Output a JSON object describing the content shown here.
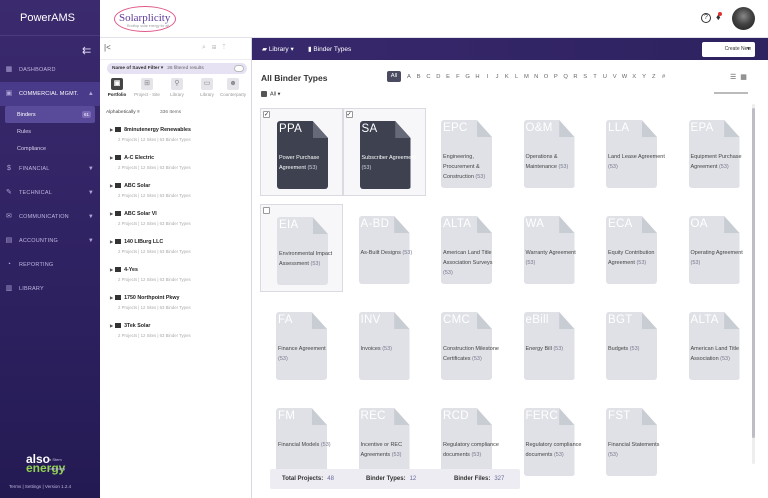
{
  "app": {
    "title": "PowerAMS"
  },
  "nav": {
    "collapse_icon": "collapse-left-icon",
    "items": [
      {
        "label": "DASHBOARD",
        "icon": "dashboard-icon"
      },
      {
        "label": "COMMERCIAL MGMT.",
        "icon": "briefcase-icon",
        "open": true
      },
      {
        "label": "FINANCIAL",
        "icon": "dollar-icon"
      },
      {
        "label": "TECHNICAL",
        "icon": "wrench-icon"
      },
      {
        "label": "COMMUNICATION",
        "icon": "chat-icon"
      },
      {
        "label": "ACCOUNTING",
        "icon": "calculator-icon"
      },
      {
        "label": "REPORTING",
        "icon": "report-icon"
      },
      {
        "label": "LIBRARY",
        "icon": "library-icon"
      }
    ],
    "sub_items": [
      {
        "label": "Binders",
        "badge": "61"
      },
      {
        "label": "Rules"
      },
      {
        "label": "Compliance"
      }
    ],
    "logo": {
      "line1": "also",
      "line2": "energy",
      "tag": "a Stem company"
    },
    "footer": {
      "terms": "Terms",
      "settings": "Settings",
      "version": "Version 1.2.4"
    }
  },
  "header": {
    "logo_text": "Solarplicity",
    "logo_tagline": "Rooftop solar energy for all"
  },
  "toolbar": {
    "breadcrumb_library": "Library",
    "breadcrumb_current": "Binder Types",
    "create_button": "Create New"
  },
  "tree": {
    "filter": {
      "name": "Name of Saved Filter",
      "results": "26 filtered results"
    },
    "categories": [
      {
        "label": "Portfolio",
        "icon": "portfolio-icon",
        "active": true
      },
      {
        "label": "Project - Site",
        "icon": "project-icon"
      },
      {
        "label": "Library",
        "icon": "pin-icon"
      },
      {
        "label": "Library",
        "icon": "book-icon"
      },
      {
        "label": "Counterparty",
        "icon": "people-icon"
      }
    ],
    "sort_label": "Alphabetically",
    "item_count": "336 Items",
    "nodes": [
      {
        "name": "8minutenergy Renewables",
        "stats": "2 Projects | 12 Sites | 63 Binder Types"
      },
      {
        "name": "A-C Electric",
        "stats": "2 Projects | 12 Sites | 63 Binder Types"
      },
      {
        "name": "ABC Solar",
        "stats": "2 Projects | 12 Sites | 63 Binder Types"
      },
      {
        "name": "ABC Solar VI",
        "stats": "2 Projects | 12 Sites | 63 Binder Types"
      },
      {
        "name": "140 LIBurg LLC",
        "stats": "2 Projects | 12 Sites | 63 Binder Types"
      },
      {
        "name": "4-Yes",
        "stats": "2 Projects | 12 Sites | 63 Binder Types"
      },
      {
        "name": "1750 Northpoint Pkwy",
        "stats": "2 Projects | 12 Sites | 63 Binder Types"
      },
      {
        "name": "3Tek Solar",
        "stats": "2 Projects | 12 Sites | 63 Binder Types"
      }
    ]
  },
  "main": {
    "title": "All Binder Types",
    "alphabet": [
      "All",
      "A",
      "B",
      "C",
      "D",
      "E",
      "F",
      "G",
      "H",
      "I",
      "J",
      "K",
      "L",
      "M",
      "N",
      "O",
      "P",
      "Q",
      "R",
      "S",
      "T",
      "U",
      "V",
      "W",
      "X",
      "Y",
      "Z",
      "#"
    ],
    "select_all": "All",
    "cards": [
      {
        "abbr": "PPA",
        "label": "Power Purchase Agreement",
        "count": "(53)",
        "dark": true,
        "checked": true
      },
      {
        "abbr": "SA",
        "label": "Subscriber Agreement",
        "count": "(53)",
        "dark": true,
        "checked": true
      },
      {
        "abbr": "EPC",
        "label": "Engineering, Procurement & Construction",
        "count": "(53)"
      },
      {
        "abbr": "O&M",
        "label": "Operations & Maintenance",
        "count": "(53)"
      },
      {
        "abbr": "LLA",
        "label": "Land Lease Agreement",
        "count": "(53)"
      },
      {
        "abbr": "EPA",
        "label": "Equipment Purchase Agreement",
        "count": "(53)"
      },
      {
        "abbr": "EIA",
        "label": "Environmental Impact Assessment",
        "count": "(53)",
        "checked": false,
        "selbox": true
      },
      {
        "abbr": "A-BD",
        "label": "As-Built Designs",
        "count": "(53)"
      },
      {
        "abbr": "ALTA",
        "label": "American Land Title Association Surveys",
        "count": "(53)"
      },
      {
        "abbr": "WA",
        "label": "Warranty Agreement",
        "count": "(53)"
      },
      {
        "abbr": "ECA",
        "label": "Equity Contribution Agreement",
        "count": "(53)"
      },
      {
        "abbr": "OA",
        "label": "Operating Agreement",
        "count": "(53)"
      },
      {
        "abbr": "FA",
        "label": "Finance Agreement",
        "count": "(53)"
      },
      {
        "abbr": "INV",
        "label": "Invoices",
        "count": "(53)"
      },
      {
        "abbr": "CMC",
        "label": "Construction Milestone Certificates",
        "count": "(53)"
      },
      {
        "abbr": "eBill",
        "label": "Energy Bill",
        "count": "(53)"
      },
      {
        "abbr": "BGT",
        "label": "Budgets",
        "count": "(53)"
      },
      {
        "abbr": "ALTA",
        "label": "American Land Title Association",
        "count": "(53)"
      },
      {
        "abbr": "FM",
        "label": "Financial Models",
        "count": "(53)"
      },
      {
        "abbr": "REC",
        "label": "Incentive or REC Agreements",
        "count": "(53)"
      },
      {
        "abbr": "RCD",
        "label": "Regulatory compliance documents",
        "count": "(53)"
      },
      {
        "abbr": "FERC",
        "label": "Regulatory compliance documents",
        "count": "(53)"
      },
      {
        "abbr": "FST",
        "label": "Financial Statements",
        "count": "(53)"
      }
    ],
    "stats": {
      "projects_label": "Total Projects:",
      "projects_value": "48",
      "types_label": "Binder Types:",
      "types_value": "12",
      "files_label": "Binder Files:",
      "files_value": "327"
    }
  }
}
